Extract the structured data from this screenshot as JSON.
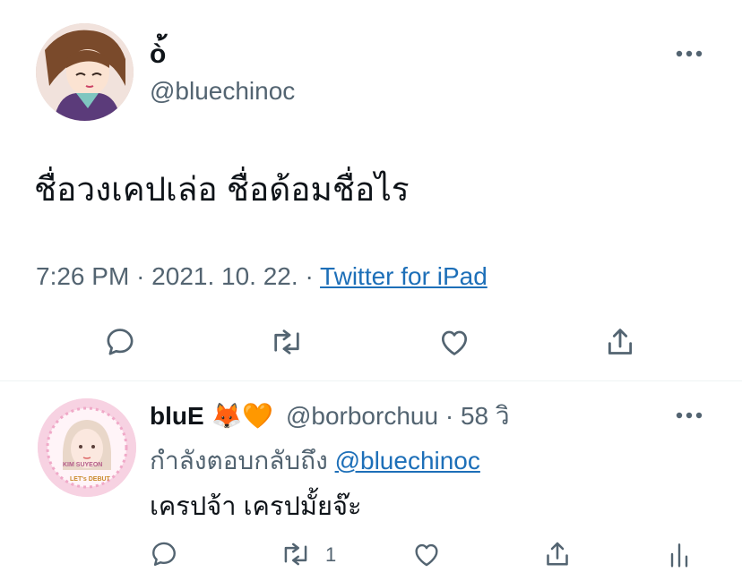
{
  "main_tweet": {
    "display_name": "ò้",
    "handle": "@bluechinoc",
    "text": "ชื่อวงเคปเล่อ ชื่อด้อมชื่อไร",
    "time": "7:26 PM",
    "date": "2021. 10. 22.",
    "separator": "·",
    "source": "Twitter for iPad",
    "avatar_icon": "anime-character-avatar",
    "more_icon": "more-dots-icon",
    "actions": [
      "reply-icon",
      "retweet-icon",
      "like-icon",
      "share-icon"
    ]
  },
  "reply": {
    "display_name": "bluE",
    "name_emojis": "🦊🧡",
    "handle": "@borborchuu",
    "time_ago": "58 วิ",
    "replying_to_label": "กำลังตอบกลับถึง",
    "replying_to_handle": "@bluechinoc",
    "text": "เครปจ้า เครปมั้ยจ๊ะ",
    "retweet_count": "1",
    "avatar_caption_1": "KIM SUYEON",
    "avatar_caption_2": "LET's DEBUT",
    "actions": [
      "reply-icon",
      "retweet-icon",
      "like-icon",
      "share-icon",
      "analytics-icon"
    ]
  },
  "colors": {
    "text": "#0f1419",
    "muted": "#536471",
    "link": "#1d6fb8",
    "divider": "#eff3f4"
  }
}
